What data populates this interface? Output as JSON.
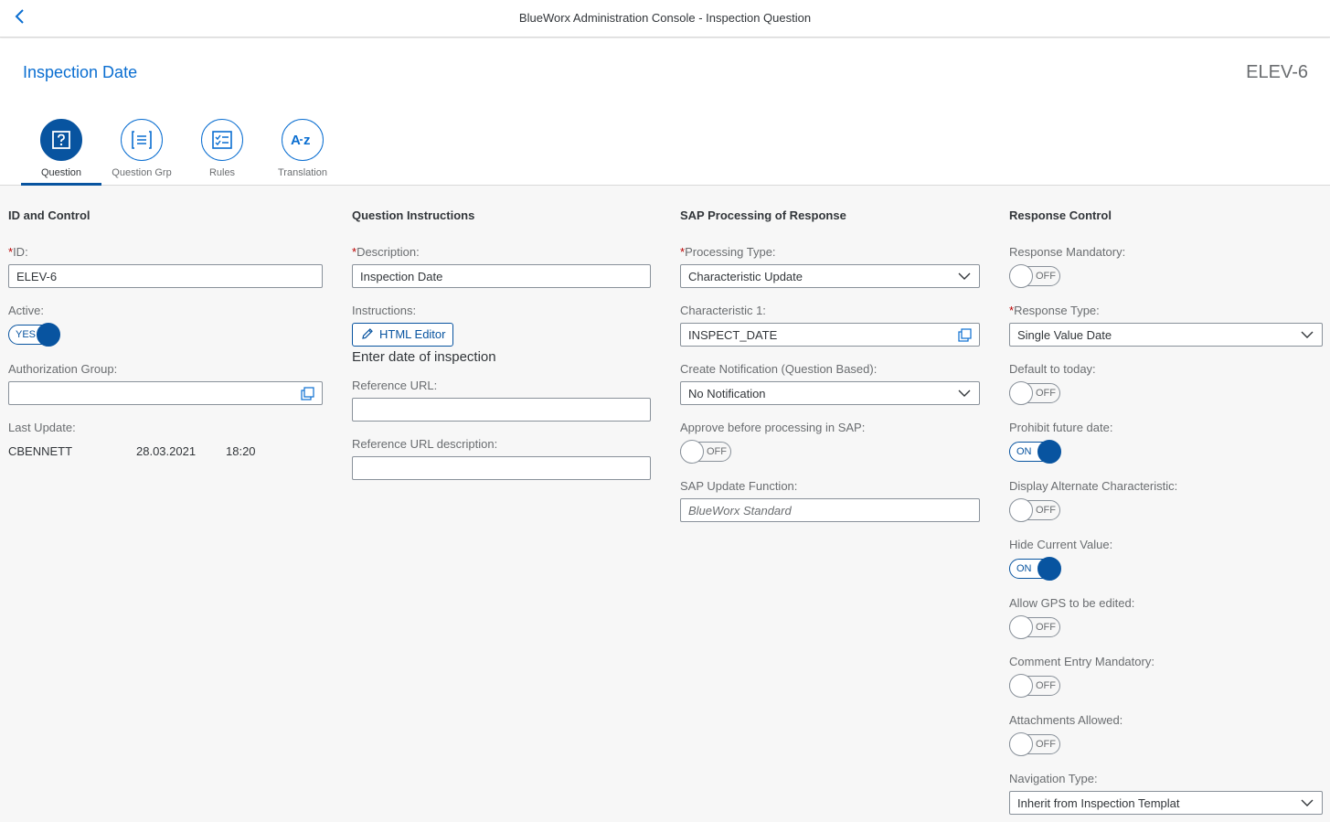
{
  "shell": {
    "title": "BlueWorx Administration Console - Inspection Question"
  },
  "header": {
    "title": "Inspection Date",
    "object_id": "ELEV-6"
  },
  "tabs": [
    {
      "label": "Question",
      "icon": "question-mark-icon",
      "selected": true
    },
    {
      "label": "Question Grp",
      "icon": "list-icon",
      "selected": false
    },
    {
      "label": "Rules",
      "icon": "checklist-icon",
      "selected": false
    },
    {
      "label": "Translation",
      "icon": "a-z-icon",
      "selected": false
    }
  ],
  "id_control": {
    "title": "ID and Control",
    "id_label": "ID:",
    "id_value": "ELEV-6",
    "active_label": "Active:",
    "active_state": "YES",
    "auth_group_label": "Authorization Group:",
    "auth_group_value": "",
    "last_update_label": "Last Update:",
    "last_update_user": "CBENNETT",
    "last_update_date": "28.03.2021",
    "last_update_time": "18:20"
  },
  "instructions": {
    "title": "Question Instructions",
    "description_label": "Description:",
    "description_value": "Inspection Date",
    "instructions_label": "Instructions:",
    "html_editor_button": "HTML Editor",
    "instructions_text": "Enter date of inspection",
    "ref_url_label": "Reference URL:",
    "ref_url_value": "",
    "ref_url_desc_label": "Reference URL description:",
    "ref_url_desc_value": ""
  },
  "sap_processing": {
    "title": "SAP Processing of Response",
    "processing_type_label": "Processing Type:",
    "processing_type_value": "Characteristic Update",
    "characteristic_label": "Characteristic 1:",
    "characteristic_value": "INSPECT_DATE",
    "create_notification_label": "Create Notification (Question Based):",
    "create_notification_value": "No Notification",
    "approve_label": "Approve before processing in SAP:",
    "approve_state": "OFF",
    "update_function_label": "SAP Update Function:",
    "update_function_placeholder": "BlueWorx Standard"
  },
  "response_control": {
    "title": "Response Control",
    "response_mandatory_label": "Response Mandatory:",
    "response_mandatory_state": "OFF",
    "response_type_label": "Response Type:",
    "response_type_value": "Single Value Date",
    "default_today_label": "Default to today:",
    "default_today_state": "OFF",
    "prohibit_future_label": "Prohibit future date:",
    "prohibit_future_state": "ON",
    "display_alt_label": "Display Alternate Characteristic:",
    "display_alt_state": "OFF",
    "hide_current_label": "Hide Current Value:",
    "hide_current_state": "ON",
    "allow_gps_label": "Allow GPS to be edited:",
    "allow_gps_state": "OFF",
    "comment_mandatory_label": "Comment Entry Mandatory:",
    "comment_mandatory_state": "OFF",
    "attachments_label": "Attachments Allowed:",
    "attachments_state": "OFF",
    "navigation_type_label": "Navigation Type:",
    "navigation_type_value": "Inherit from Inspection Templat"
  },
  "colors": {
    "brand_blue": "#0a6ed1",
    "selected_blue": "#0854a0",
    "required_red": "#bb0000",
    "background": "#f7f7f7"
  }
}
